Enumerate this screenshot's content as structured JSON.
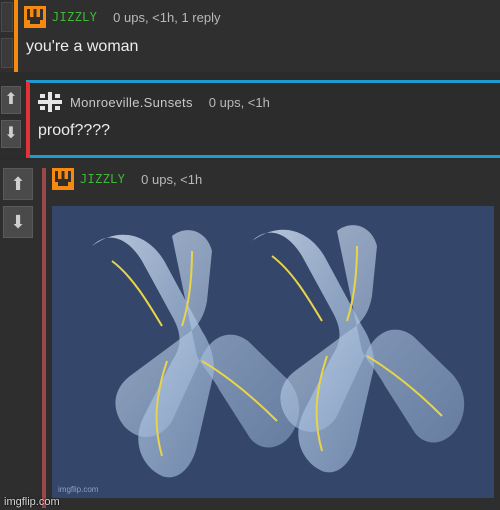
{
  "comments": [
    {
      "username": "JIZZLY",
      "meta": "0 ups, <1h, 1 reply",
      "text": "you're a woman",
      "avatar": "crown-icon",
      "accent_color": "#f48a12"
    },
    {
      "username": "Monroeville.Sunsets",
      "meta": "0 ups, <1h",
      "text": "proof????",
      "avatar": "plus-icon",
      "accent_color": "#e03434"
    },
    {
      "username": "JIZZLY",
      "meta": "0 ups, <1h",
      "avatar": "crown-icon",
      "accent_color": "#9a4848",
      "image_caption": "imgflip.com"
    }
  ],
  "vote": {
    "up": "⬆",
    "down": "⬇"
  },
  "footer": {
    "watermark": "imgflip.com"
  },
  "colors": {
    "green_username": "#3fb935",
    "reply_highlight": "#1e9ccf"
  }
}
